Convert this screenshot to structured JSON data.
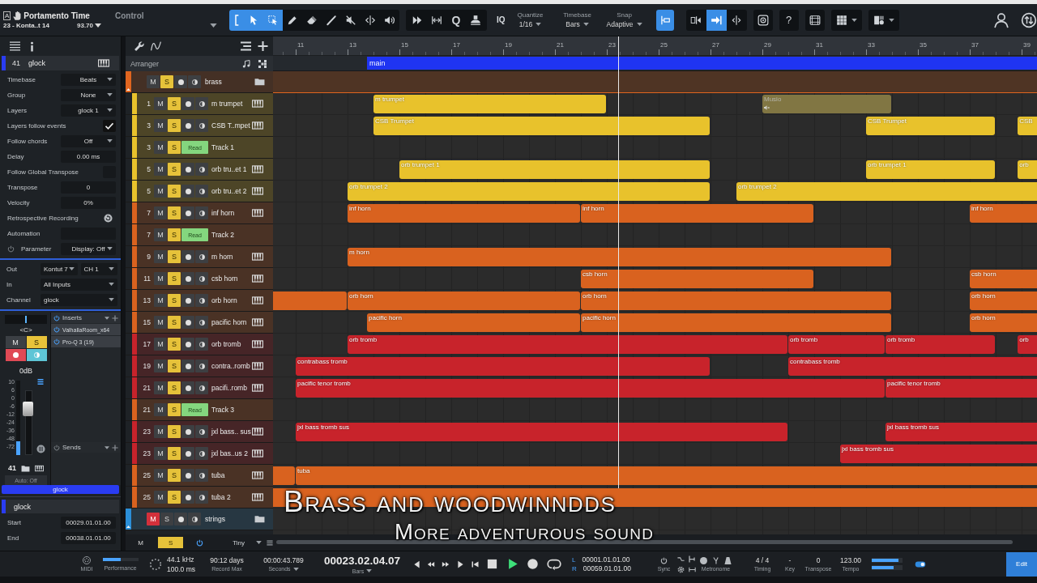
{
  "toolbar": {
    "song": {
      "badge": "A",
      "title": "Portamento Time",
      "track": "23 - Konta..t 14",
      "value": "93.70"
    },
    "control": "Control",
    "tools": [
      {
        "kind": "range",
        "selected": true
      },
      {
        "kind": "arrow",
        "selected": true
      },
      {
        "kind": "select",
        "selected": true
      },
      {
        "kind": "pencil",
        "selected": false
      },
      {
        "kind": "eraser",
        "selected": false
      },
      {
        "kind": "paint",
        "selected": false
      },
      {
        "kind": "mute",
        "selected": false
      },
      {
        "kind": "split",
        "selected": false
      },
      {
        "kind": "listen",
        "selected": false
      }
    ],
    "edit_tools": [
      {
        "kind": "bend"
      },
      {
        "kind": "stretch"
      },
      {
        "kind": "letter",
        "text": "Q"
      },
      {
        "kind": "stamp"
      }
    ],
    "iq": "IQ",
    "selectors": [
      {
        "label": "Quantize",
        "value": "1/16"
      },
      {
        "label": "Timebase",
        "value": "Bars"
      },
      {
        "label": "Snap",
        "value": "Adaptive"
      }
    ],
    "snap_toggle": {
      "selected": true
    },
    "snap_modes": [
      {
        "kind": "snap-back",
        "selected": false
      },
      {
        "kind": "snap-forward",
        "selected": true
      },
      {
        "kind": "snap-center",
        "selected": false
      }
    ],
    "view_buttons": [
      {
        "kind": "target",
        "menu": false
      },
      {
        "kind": "letter",
        "text": "?",
        "menu": false
      },
      {
        "kind": "film",
        "menu": false
      },
      {
        "kind": "grid",
        "menu": true
      },
      {
        "kind": "layout",
        "menu": true
      }
    ],
    "account": [
      {
        "kind": "user"
      },
      {
        "kind": "sync"
      }
    ]
  },
  "inspector": {
    "track": {
      "number": "41",
      "name": "glock",
      "color": "#2a3cf2"
    },
    "properties": [
      {
        "kind": "select",
        "label": "Timebase",
        "value": "Beats"
      },
      {
        "kind": "select",
        "label": "Group",
        "value": "None"
      },
      {
        "kind": "select",
        "label": "Layers",
        "value": "glock 1"
      },
      {
        "kind": "checkbox",
        "label": "Layers follow events",
        "checked": true
      },
      {
        "kind": "select",
        "label": "Follow chords",
        "value": "Off"
      },
      {
        "kind": "field",
        "label": "Delay",
        "value": "0.00 ms"
      },
      {
        "kind": "checkbox",
        "label": "Follow Global Transpose",
        "checked": false
      },
      {
        "kind": "field",
        "label": "Transpose",
        "value": "0"
      },
      {
        "kind": "field",
        "label": "Velocity",
        "value": "0%"
      },
      {
        "kind": "button",
        "label": "Retrospective Recording"
      },
      {
        "kind": "field",
        "label": "Automation"
      },
      {
        "kind": "parameter",
        "label": "Parameter",
        "value": "Display: Off"
      }
    ],
    "routing": [
      {
        "label": "Out",
        "values": [
          "Kontut 7",
          "CH 1"
        ]
      },
      {
        "label": "In",
        "values": [
          "All Inputs"
        ]
      },
      {
        "label": "Channel",
        "values": [
          "glock"
        ]
      }
    ],
    "channel": {
      "pan": {
        "text": "<C>",
        "level": 0.5
      },
      "mute": {
        "text": "M",
        "on": false
      },
      "solo": {
        "text": "S",
        "on": true
      },
      "record": true,
      "monitor": true,
      "volume": "0dB",
      "meter_scale": [
        "10",
        "6",
        "0",
        "-6",
        "-12",
        "-24",
        "-36",
        "-48",
        "-72"
      ],
      "meter": {
        "level": 0.18
      },
      "fader": {
        "level": 0.72
      },
      "number": "41",
      "automation": "Auto: Off",
      "name": "glock"
    },
    "inserts": {
      "title": "Inserts",
      "on": true,
      "items": [
        {
          "name": "ValhallaRoom_x64",
          "on": true
        },
        {
          "name": "Pro-Q 3 (19)",
          "on": true
        }
      ]
    },
    "sends": {
      "title": "Sends",
      "on": false
    },
    "event": {
      "name": "glock",
      "fields": [
        {
          "label": "Start",
          "value": "00029.01.01.00"
        },
        {
          "label": "End",
          "value": "00038.01.01.00"
        }
      ]
    }
  },
  "tracks": {
    "title": "Arranger",
    "folders": [
      {
        "name": "brass",
        "color": "#e0651f",
        "expanded": true,
        "mute": {
          "text": "M",
          "on": false
        },
        "solo": {
          "text": "S",
          "on": true
        },
        "children": [
          {
            "kind": "instrument",
            "number": "1",
            "name": "m trumpet",
            "color": "#e8c22c",
            "mute": {
              "text": "M",
              "on": false
            },
            "solo": {
              "text": "S",
              "on": true
            },
            "clips": [
              {
                "label": "m trumpet",
                "muted": false
              },
              {
                "label": "Musio",
                "muted": true
              }
            ]
          },
          {
            "kind": "instrument",
            "number": "3",
            "name": "CSB T..mpet",
            "color": "#e8c22c",
            "mute": {
              "text": "M",
              "on": false
            },
            "solo": {
              "text": "S",
              "on": true
            },
            "clips": [
              {
                "label": "CSB Trumpet",
                "muted": false
              },
              {
                "label": "CSB Trumpet",
                "muted": false
              },
              {
                "label": "CSB",
                "muted": false
              }
            ]
          },
          {
            "kind": "automation",
            "number": "3",
            "name": "Track 1",
            "color": "#e8c22c",
            "mode": "Read",
            "mute": {
              "text": "M",
              "on": false
            },
            "solo": {
              "text": "S",
              "on": true
            }
          },
          {
            "kind": "instrument",
            "number": "5",
            "name": "orb tru..et 1",
            "color": "#e8c22c",
            "mute": {
              "text": "M",
              "on": false
            },
            "solo": {
              "text": "S",
              "on": true
            },
            "clips": [
              {
                "label": "orb trumpet 1",
                "muted": false
              },
              {
                "label": "orb trumpet 1",
                "muted": false
              },
              {
                "label": "orb",
                "muted": false
              }
            ]
          },
          {
            "kind": "instrument",
            "number": "5",
            "name": "orb tru..et 2",
            "color": "#e8c22c",
            "mute": {
              "text": "M",
              "on": false
            },
            "solo": {
              "text": "S",
              "on": true
            },
            "clips": [
              {
                "label": "orb trumpet 2",
                "muted": false
              },
              {
                "label": "orb trumpet 2",
                "muted": false
              }
            ]
          },
          {
            "kind": "instrument",
            "number": "7",
            "name": "inf horn",
            "color": "#d9621f",
            "mute": {
              "text": "M",
              "on": false
            },
            "solo": {
              "text": "S",
              "on": true
            },
            "clips": [
              {
                "label": "inf horn",
                "muted": false
              },
              {
                "label": "inf horn",
                "muted": false
              },
              {
                "label": "inf horn",
                "muted": false
              }
            ]
          },
          {
            "kind": "automation",
            "number": "7",
            "name": "Track 2",
            "color": "#d9621f",
            "mode": "Read",
            "mute": {
              "text": "M",
              "on": false
            },
            "solo": {
              "text": "S",
              "on": true
            }
          },
          {
            "kind": "instrument",
            "number": "9",
            "name": "m horn",
            "color": "#d9621f",
            "mute": {
              "text": "M",
              "on": false
            },
            "solo": {
              "text": "S",
              "on": true
            },
            "clips": [
              {
                "label": "m horn",
                "muted": false
              }
            ]
          },
          {
            "kind": "instrument",
            "number": "11",
            "name": "csb horn",
            "color": "#d9621f",
            "mute": {
              "text": "M",
              "on": false
            },
            "solo": {
              "text": "S",
              "on": true
            },
            "clips": [
              {
                "label": "csb horn",
                "muted": false
              },
              {
                "label": "csb horn",
                "muted": false
              }
            ]
          },
          {
            "kind": "instrument",
            "number": "13",
            "name": "orb horn",
            "color": "#d9621f",
            "mute": {
              "text": "M",
              "on": false
            },
            "solo": {
              "text": "S",
              "on": true
            },
            "clips": [
              {
                "muted": false
              },
              {
                "label": "orb horn",
                "muted": false
              },
              {
                "label": "orb horn",
                "muted": false
              },
              {
                "label": "orb horn",
                "muted": false
              }
            ]
          },
          {
            "kind": "instrument",
            "number": "15",
            "name": "pacific horn",
            "color": "#d9621f",
            "mute": {
              "text": "M",
              "on": false
            },
            "solo": {
              "text": "S",
              "on": true
            },
            "clips": [
              {
                "label": "pacific horn",
                "muted": false
              },
              {
                "label": "pacific horn",
                "muted": false
              },
              {
                "label": "orb horn",
                "muted": false
              }
            ]
          },
          {
            "kind": "instrument",
            "number": "17",
            "name": "orb tromb",
            "color": "#c8232b",
            "mute": {
              "text": "M",
              "on": false
            },
            "solo": {
              "text": "S",
              "on": true
            },
            "clips": [
              {
                "label": "orb tromb",
                "muted": false
              },
              {
                "label": "orb tromb",
                "muted": false
              },
              {
                "label": "orb tromb",
                "muted": false
              },
              {
                "label": "orb",
                "muted": false
              }
            ]
          },
          {
            "kind": "instrument",
            "number": "19",
            "name": "contra..romb",
            "color": "#c8232b",
            "mute": {
              "text": "M",
              "on": false
            },
            "solo": {
              "text": "S",
              "on": true
            },
            "clips": [
              {
                "label": "contrabass tromb",
                "muted": false
              },
              {
                "label": "contrabass tromb",
                "muted": false
              }
            ]
          },
          {
            "kind": "instrument",
            "number": "21",
            "name": "pacifi..romb",
            "color": "#c8232b",
            "mute": {
              "text": "M",
              "on": false
            },
            "solo": {
              "text": "S",
              "on": true
            },
            "clips": [
              {
                "label": "pacific tenor tromb",
                "muted": false
              },
              {
                "label": "pacific tenor tromb",
                "muted": false
              }
            ]
          },
          {
            "kind": "automation",
            "number": "21",
            "name": "Track 3",
            "color": "#d9621f",
            "mode": "Read",
            "mute": {
              "text": "M",
              "on": false
            },
            "solo": {
              "text": "S",
              "on": true
            }
          },
          {
            "kind": "instrument",
            "number": "23",
            "name": "jxl bass.. sus",
            "color": "#c8232b",
            "mute": {
              "text": "M",
              "on": false
            },
            "solo": {
              "text": "S",
              "on": true
            },
            "clips": [
              {
                "label": "jxl bass tromb sus",
                "muted": false
              },
              {
                "label": "jxl bass tromb sus",
                "muted": false
              }
            ]
          },
          {
            "kind": "instrument",
            "number": "23",
            "name": "jxl bas..us 2",
            "color": "#c8232b",
            "mute": {
              "text": "M",
              "on": false
            },
            "solo": {
              "text": "S",
              "on": true
            },
            "clips": [
              {
                "label": "jxl bass tromb sus",
                "muted": false
              }
            ]
          },
          {
            "kind": "instrument",
            "number": "25",
            "name": "tuba",
            "color": "#d9621f",
            "mute": {
              "text": "M",
              "on": false
            },
            "solo": {
              "text": "S",
              "on": true
            },
            "clips": [
              {
                "muted": false
              },
              {
                "label": "tuba",
                "muted": false
              }
            ]
          },
          {
            "kind": "instrument",
            "number": "25",
            "name": "tuba 2",
            "color": "#d9621f",
            "mute": {
              "text": "M",
              "on": false
            },
            "solo": {
              "text": "S",
              "on": true
            },
            "clips": [
              {
                "muted": false
              }
            ]
          }
        ]
      },
      {
        "name": "strings",
        "color": "#2b8fd8",
        "expanded": false,
        "mute": {
          "text": "M",
          "on": true
        },
        "solo": {
          "text": "S",
          "on": false
        }
      }
    ],
    "footer": {
      "mute": "M",
      "solo": "S",
      "solo_on": true,
      "power_on": true,
      "height": "Tiny"
    }
  },
  "arrange": {
    "ruler": [
      "11",
      "13",
      "15",
      "17",
      "19",
      "21",
      "23",
      "25",
      "27",
      "29",
      "31",
      "33",
      "35",
      "37",
      "39"
    ],
    "sections": [
      {
        "name": "main"
      }
    ]
  },
  "transport": {
    "midi": "MIDI",
    "performance": {
      "label": "Performance",
      "level": 0.5
    },
    "sample_rate": "44.1 kHz",
    "latency": "100.0 ms",
    "record_max": {
      "value": "90:12 days",
      "label": "Record Max"
    },
    "seconds": {
      "value": "00:00:43.789",
      "label": "Seconds"
    },
    "bars": {
      "value": "00023.02.04.07",
      "label": "Bars"
    },
    "controls": [
      {
        "kind": "back",
        "on": false
      },
      {
        "kind": "rewind",
        "on": false
      },
      {
        "kind": "forward",
        "on": false
      },
      {
        "kind": "next",
        "on": false
      },
      {
        "kind": "to-start",
        "on": false
      },
      {
        "kind": "stop",
        "on": false
      },
      {
        "kind": "play",
        "on": true
      },
      {
        "kind": "record",
        "on": false
      },
      {
        "kind": "loop",
        "on": false
      }
    ],
    "loop": [
      {
        "letter": "L",
        "value": "00001.01.01.00"
      },
      {
        "letter": "R",
        "value": "00059.01.01.00"
      }
    ],
    "sync": "Sync",
    "metronome": "Metronome",
    "fields": [
      {
        "value": "4 / 4",
        "label": "Timing"
      },
      {
        "value": "-",
        "label": "Key"
      },
      {
        "value": "0",
        "label": "Transpose"
      },
      {
        "value": "123.00",
        "label": "Tempo"
      }
    ],
    "meters": [
      {
        "level": 0.88
      },
      {
        "level": 0.7
      }
    ],
    "edit": "Edit"
  },
  "caption": {
    "title": "Brass and woodwinndds",
    "subtitle": "More adventurous sound"
  }
}
